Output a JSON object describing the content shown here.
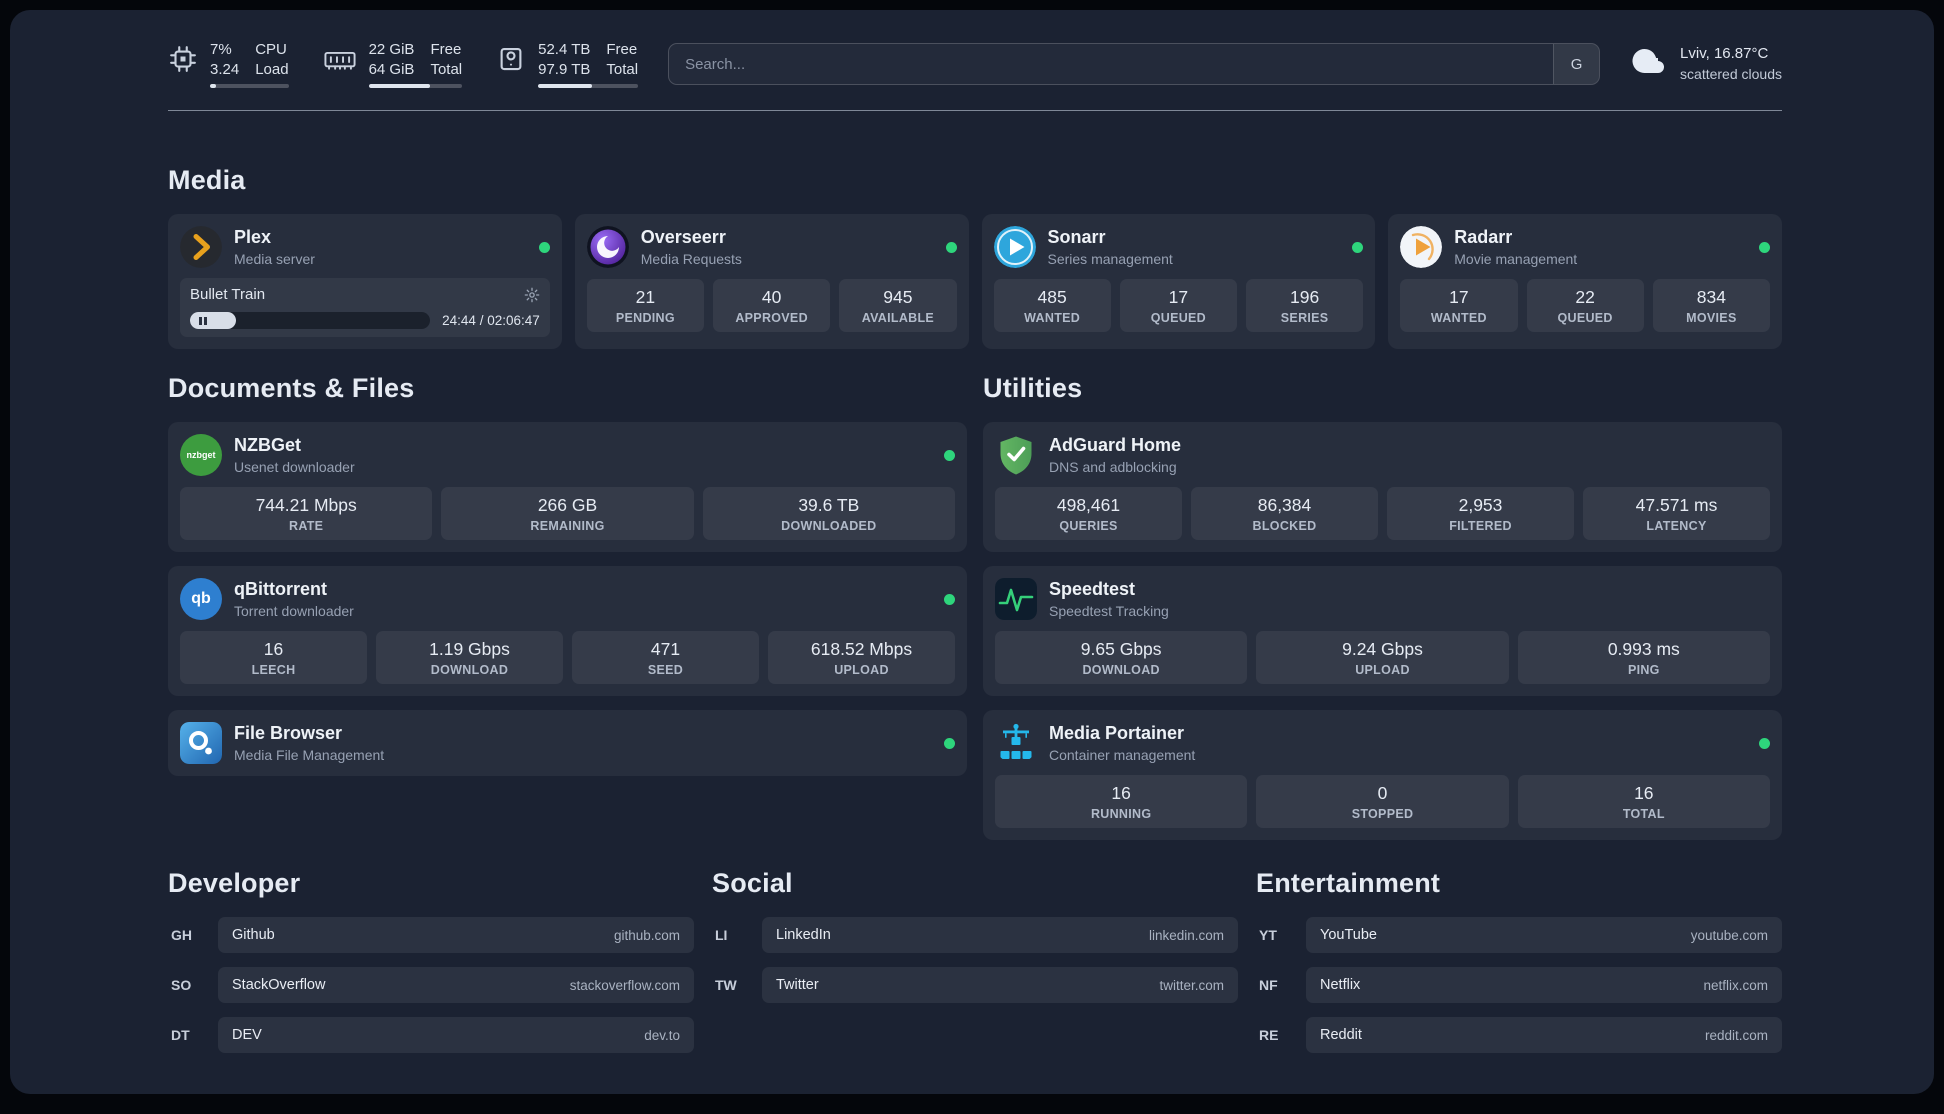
{
  "colors": {
    "status_online": "#2ed57c",
    "plex_accent": "#e8a11d",
    "adguard_green": "#5cb660",
    "portainer_blue": "#24b8eb",
    "speedtest_green": "#35d07a"
  },
  "topbar": {
    "cpu": {
      "icon": "cpu-icon",
      "percent": "7%",
      "load": "3.24",
      "label_top": "CPU",
      "label_bottom": "Load",
      "bar": 7
    },
    "memory": {
      "icon": "memory-icon",
      "free": "22 GiB",
      "total": "64 GiB",
      "label_top": "Free",
      "label_bottom": "Total",
      "bar": 66
    },
    "disk": {
      "icon": "disk-icon",
      "free": "52.4 TB",
      "total": "97.9 TB",
      "label_top": "Free",
      "label_bottom": "Total",
      "bar": 54
    },
    "search": {
      "placeholder": "Search...",
      "provider_label": "G"
    },
    "weather": {
      "icon": "cloud-icon",
      "location": "Lviv, 16.87°C",
      "condition": "scattered clouds"
    }
  },
  "media": {
    "title": "Media",
    "cards": [
      {
        "name": "Plex",
        "subtitle": "Media server",
        "player": {
          "track": "Bullet Train",
          "time": "24:44 / 02:06:47",
          "progress": 19
        }
      },
      {
        "name": "Overseerr",
        "subtitle": "Media Requests",
        "stats": [
          {
            "value": "21",
            "label": "PENDING"
          },
          {
            "value": "40",
            "label": "APPROVED"
          },
          {
            "value": "945",
            "label": "AVAILABLE"
          }
        ]
      },
      {
        "name": "Sonarr",
        "subtitle": "Series management",
        "stats": [
          {
            "value": "485",
            "label": "WANTED"
          },
          {
            "value": "17",
            "label": "QUEUED"
          },
          {
            "value": "196",
            "label": "SERIES"
          }
        ]
      },
      {
        "name": "Radarr",
        "subtitle": "Movie management",
        "stats": [
          {
            "value": "17",
            "label": "WANTED"
          },
          {
            "value": "22",
            "label": "QUEUED"
          },
          {
            "value": "834",
            "label": "MOVIES"
          }
        ]
      }
    ]
  },
  "documents": {
    "title": "Documents & Files",
    "cards": [
      {
        "name": "NZBGet",
        "subtitle": "Usenet downloader",
        "stats": [
          {
            "value": "744.21 Mbps",
            "label": "RATE"
          },
          {
            "value": "266 GB",
            "label": "REMAINING"
          },
          {
            "value": "39.6 TB",
            "label": "DOWNLOADED"
          }
        ]
      },
      {
        "name": "qBittorrent",
        "subtitle": "Torrent downloader",
        "stats": [
          {
            "value": "16",
            "label": "LEECH"
          },
          {
            "value": "1.19 Gbps",
            "label": "DOWNLOAD"
          },
          {
            "value": "471",
            "label": "SEED"
          },
          {
            "value": "618.52 Mbps",
            "label": "UPLOAD"
          }
        ]
      },
      {
        "name": "File Browser",
        "subtitle": "Media File Management"
      }
    ]
  },
  "utilities": {
    "title": "Utilities",
    "cards": [
      {
        "name": "AdGuard Home",
        "subtitle": "DNS and adblocking",
        "stats": [
          {
            "value": "498,461",
            "label": "QUERIES"
          },
          {
            "value": "86,384",
            "label": "BLOCKED"
          },
          {
            "value": "2,953",
            "label": "FILTERED"
          },
          {
            "value": "47.571 ms",
            "label": "LATENCY"
          }
        ]
      },
      {
        "name": "Speedtest",
        "subtitle": "Speedtest Tracking",
        "stats": [
          {
            "value": "9.65 Gbps",
            "label": "DOWNLOAD"
          },
          {
            "value": "9.24 Gbps",
            "label": "UPLOAD"
          },
          {
            "value": "0.993 ms",
            "label": "PING"
          }
        ]
      },
      {
        "name": "Media Portainer",
        "subtitle": "Container management",
        "stats": [
          {
            "value": "16",
            "label": "RUNNING"
          },
          {
            "value": "0",
            "label": "STOPPED"
          },
          {
            "value": "16",
            "label": "TOTAL"
          }
        ]
      }
    ]
  },
  "bookmarks": {
    "groups": [
      {
        "title": "Developer",
        "items": [
          {
            "abbr": "GH",
            "name": "Github",
            "domain": "github.com"
          },
          {
            "abbr": "SO",
            "name": "StackOverflow",
            "domain": "stackoverflow.com"
          },
          {
            "abbr": "DT",
            "name": "DEV",
            "domain": "dev.to"
          }
        ]
      },
      {
        "title": "Social",
        "items": [
          {
            "abbr": "LI",
            "name": "LinkedIn",
            "domain": "linkedin.com"
          },
          {
            "abbr": "TW",
            "name": "Twitter",
            "domain": "twitter.com"
          }
        ]
      },
      {
        "title": "Entertainment",
        "items": [
          {
            "abbr": "YT",
            "name": "YouTube",
            "domain": "youtube.com"
          },
          {
            "abbr": "NF",
            "name": "Netflix",
            "domain": "netflix.com"
          },
          {
            "abbr": "RE",
            "name": "Reddit",
            "domain": "reddit.com"
          }
        ]
      }
    ]
  }
}
